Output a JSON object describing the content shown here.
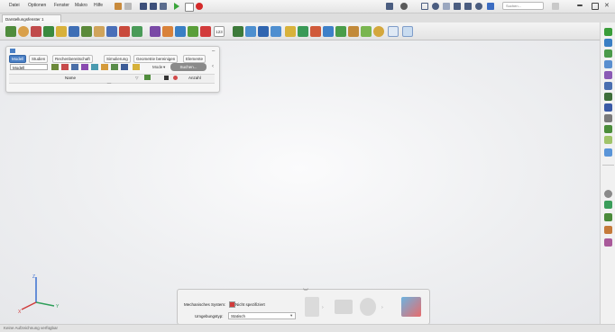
{
  "menu": [
    "Datei",
    "Optionen",
    "Fenster",
    "Makro",
    "Hilfe"
  ],
  "search": {
    "placeholder": "Suchen..."
  },
  "document_tab": "Darstellungsfenster 1",
  "toolbar": {
    "counter": "123"
  },
  "panel": {
    "tabs": [
      "Modell",
      "Studien",
      "Rechenbereitschaft",
      "Simulierung",
      "Geometrie bereinigen",
      "Elemente"
    ],
    "active_tab": "Modell",
    "dropdown": "Modell",
    "filter_mode": "Mode",
    "search_button": "Suchen...",
    "columns": {
      "name": "Name",
      "count": "Anzahl"
    }
  },
  "dialog": {
    "system_label": "Mechanisches System:",
    "system_value": "Nicht spezifiziert",
    "env_label": "Umgebungstyp:",
    "env_value": "Statisch"
  },
  "status": "Keine Aufzeichnung verfügbar",
  "axes": {
    "y": "Y",
    "z": "Z",
    "x": "X"
  }
}
